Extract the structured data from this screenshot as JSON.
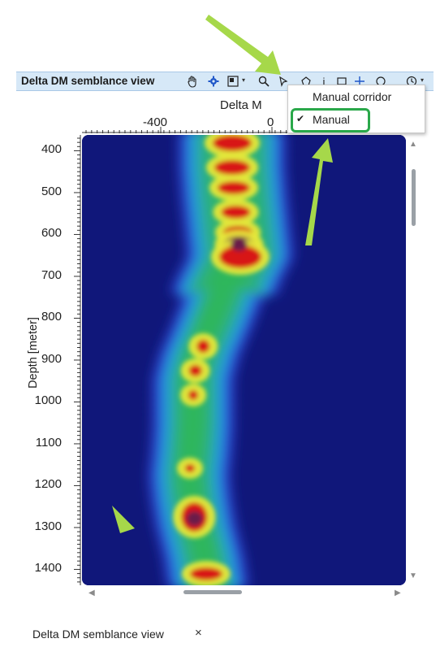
{
  "window": {
    "title": "Delta DM semblance view",
    "tab_label": "Delta DM semblance view",
    "tab_close": "×"
  },
  "toolbar": {
    "icons": [
      "hand-pan-icon",
      "gear-icon",
      "zoom-box-icon",
      "magnifier-icon",
      "pick-tool-icon",
      "polygon-icon",
      "info-icon",
      "rectangle-icon",
      "fit-icon",
      "settings-icon",
      "clock-icon"
    ]
  },
  "menu": {
    "items": [
      {
        "label": "Manual corridor",
        "checked": false
      },
      {
        "label": "Manual",
        "checked": true
      }
    ]
  },
  "chart_data": {
    "type": "heatmap",
    "xlabel": "Delta M",
    "ylabel": "Depth [meter]",
    "x_ticks": [
      "-400",
      "0"
    ],
    "y_ticks": [
      "400",
      "500",
      "600",
      "700",
      "800",
      "900",
      "1000",
      "1100",
      "1200",
      "1300",
      "1400"
    ],
    "colors": {
      "background": "#10177a",
      "low": "#2f4bd8",
      "mid": "#19c0e0",
      "green": "#2fbf3a",
      "yellow": "#e7e83a",
      "red": "#d81919",
      "peak": "#6a1a4a"
    }
  }
}
